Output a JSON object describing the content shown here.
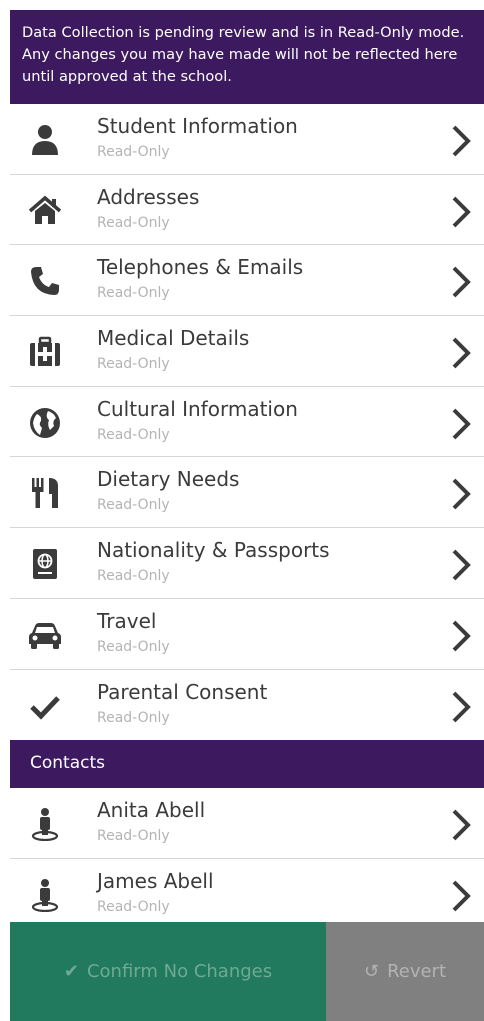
{
  "banner": {
    "text": "Data Collection is pending review and is in Read-Only mode. Any changes you may have made will not be reflected here until approved at the school."
  },
  "sections": [
    {
      "label": "Student Information",
      "status": "Read-Only",
      "icon": "person-icon"
    },
    {
      "label": "Addresses",
      "status": "Read-Only",
      "icon": "home-icon"
    },
    {
      "label": "Telephones & Emails",
      "status": "Read-Only",
      "icon": "phone-icon"
    },
    {
      "label": "Medical Details",
      "status": "Read-Only",
      "icon": "medical-kit-icon"
    },
    {
      "label": "Cultural Information",
      "status": "Read-Only",
      "icon": "globe-icon"
    },
    {
      "label": "Dietary Needs",
      "status": "Read-Only",
      "icon": "cutlery-icon"
    },
    {
      "label": "Nationality & Passports",
      "status": "Read-Only",
      "icon": "passport-icon"
    },
    {
      "label": "Travel",
      "status": "Read-Only",
      "icon": "car-icon"
    },
    {
      "label": "Parental Consent",
      "status": "Read-Only",
      "icon": "checkmark-icon"
    }
  ],
  "contacts": {
    "header": "Contacts",
    "items": [
      {
        "label": "Anita Abell",
        "status": "Read-Only",
        "icon": "contact-person-icon"
      },
      {
        "label": "James Abell",
        "status": "Read-Only",
        "icon": "contact-person-icon"
      }
    ]
  },
  "footer": {
    "confirm_label": "Confirm No Changes",
    "revert_label": "Revert"
  },
  "colors": {
    "brand_purple": "#3d1a5f",
    "confirm_green": "#227a5e",
    "revert_grey": "#808080"
  }
}
